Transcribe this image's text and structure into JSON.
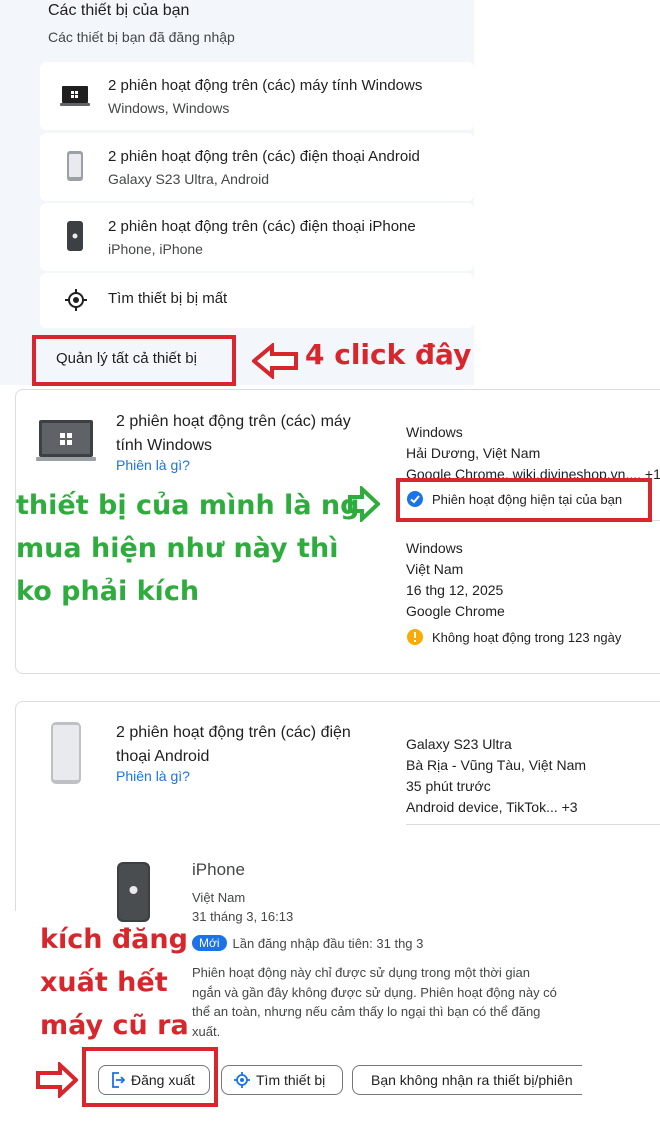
{
  "devices_panel": {
    "title": "Các thiết bị của bạn",
    "subtitle": "Các thiết bị bạn đã đăng nhập",
    "items": [
      {
        "icon": "laptop-icon",
        "title": "2 phiên hoạt động trên (các) máy tính Windows",
        "subtitle": "Windows, Windows"
      },
      {
        "icon": "android-phone-icon",
        "title": "2 phiên hoạt động trên (các) điện thoại Android",
        "subtitle": "Galaxy S23 Ultra, Android"
      },
      {
        "icon": "iphone-icon",
        "title": "2 phiên hoạt động trên (các) điện thoại iPhone",
        "subtitle": "iPhone, iPhone"
      }
    ],
    "find_device": {
      "icon": "target-icon",
      "label": "Tìm thiết bị bị mất"
    },
    "manage_all": "Quản lý tất cả thiết bị"
  },
  "annotations": {
    "step4": "4 click đây",
    "own_device_note": [
      "thiết bị của mình là ng",
      "mua hiện như này thì",
      "ko phải kích"
    ],
    "logout_note": [
      "kích đăng",
      "xuất hết",
      "máy cũ ra"
    ],
    "colors": {
      "red": "#d8262d",
      "green": "#2eac3d"
    }
  },
  "windows_card": {
    "title_lines": [
      "2 phiên hoạt động trên (các) máy",
      "tính Windows"
    ],
    "what_is": "Phiên là gì?",
    "session1": {
      "device": "Windows",
      "location": "Hải Dương, Việt Nam",
      "apps": "Google Chrome, wiki.divineshop.vn,... +1",
      "current": "Phiên hoạt động hiện tại của bạn"
    },
    "session2": {
      "device": "Windows",
      "location": "Việt Nam",
      "date": "16 thg 12, 2025",
      "browser": "Google Chrome",
      "inactive": "Không hoạt động trong 123 ngày"
    }
  },
  "android_card": {
    "title_lines": [
      "2 phiên hoạt động trên (các) điện",
      "thoại Android"
    ],
    "what_is": "Phiên là gì?",
    "session1": {
      "device": "Galaxy S23 Ultra",
      "location": "Bà Rịa - Vũng Tàu, Việt Nam",
      "time": "35 phút trước",
      "apps": "Android device, TikTok... +3"
    }
  },
  "iphone_detail": {
    "name": "iPhone",
    "location": "Việt Nam",
    "datetime": "31 tháng 3, 16:13",
    "badge": "Mới",
    "first_login": "Lần đăng nhập đầu tiên: 31 thg 3",
    "description_lines": [
      "Phiên hoạt động này chỉ được sử dụng trong một thời gian",
      "ngắn và gần đây không được sử dụng. Phiên hoạt động này có",
      "thể an toàn, nhưng nếu cảm thấy lo ngại thì bạn có thể đăng",
      "xuất."
    ],
    "buttons": {
      "logout": "Đăng xuất",
      "find": "Tìm thiết bị",
      "not_recognize": "Bạn không nhận ra thiết bị/phiên"
    }
  }
}
